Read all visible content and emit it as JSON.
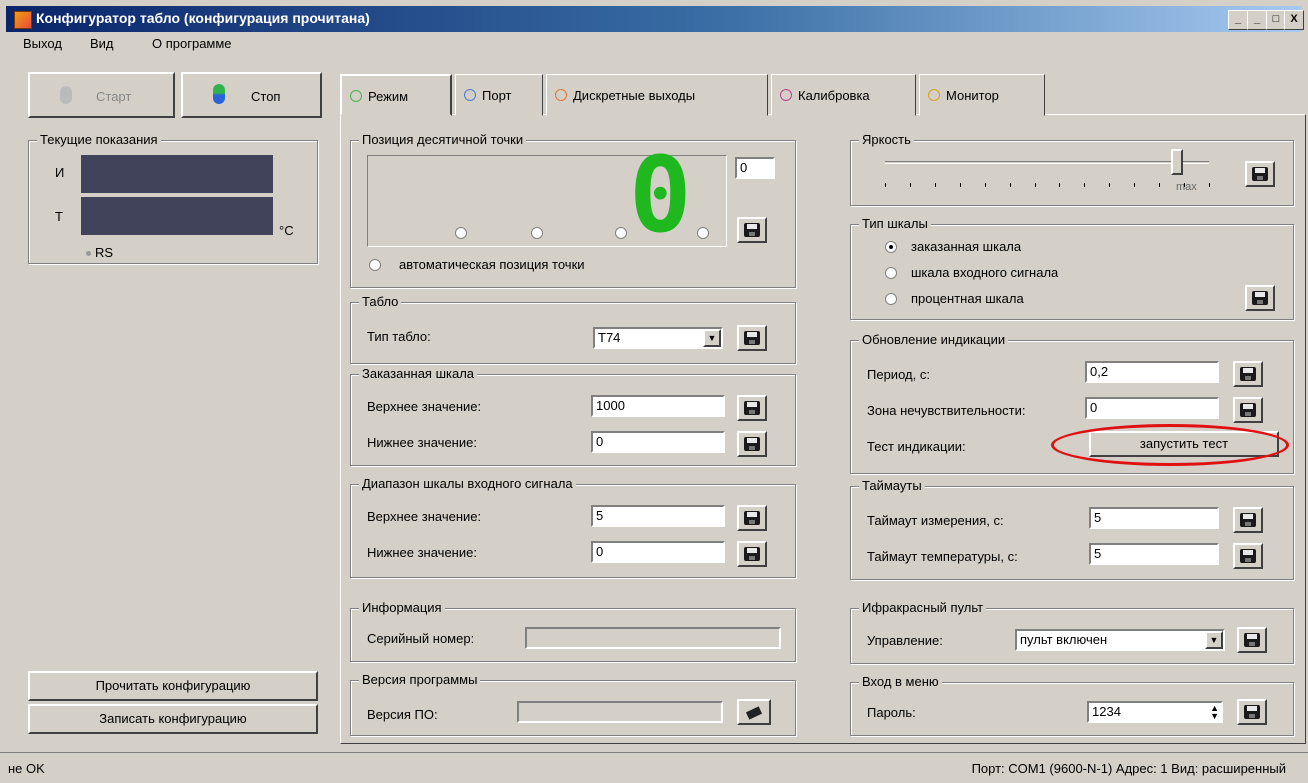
{
  "window": {
    "title": "Конфигуратор табло (конфигурация прочитана)",
    "min": "_",
    "min2": "_",
    "max": "□",
    "close": "X"
  },
  "menu": {
    "items": [
      "Выход",
      "Вид",
      "О программе"
    ]
  },
  "toolbar": {
    "start": "Старт",
    "stop": "Стоп"
  },
  "current": {
    "legend": "Текущие показания",
    "i_label": "И",
    "t_label": "Т",
    "unit": "°С",
    "rs": "RS"
  },
  "left_buttons": {
    "read": "Прочитать конфигурацию",
    "write": "Записать конфигурацию"
  },
  "tabs": [
    {
      "label": "Режим",
      "color": "#4caf50"
    },
    {
      "label": "Порт",
      "color": "#4a7bd0"
    },
    {
      "label": "Дискретные выходы",
      "color": "#e0763a"
    },
    {
      "label": "Калибровка",
      "color": "#c0408a"
    },
    {
      "label": "Монитор",
      "color": "#d4a020"
    }
  ],
  "decimal": {
    "legend": "Позиция десятичной точки",
    "value": "0",
    "digit": "0",
    "auto_label": "автоматическая позиция точки"
  },
  "tablo": {
    "legend": "Табло",
    "type_label": "Тип табло:",
    "type_value": "T74"
  },
  "ordered_scale": {
    "legend": "Заказанная шкала",
    "upper_label": "Верхнее значение:",
    "upper_value": "1000",
    "lower_label": "Нижнее значение:",
    "lower_value": "0"
  },
  "input_range": {
    "legend": "Диапазон шкалы входного сигнала",
    "upper_label": "Верхнее значение:",
    "upper_value": "5",
    "lower_label": "Нижнее значение:",
    "lower_value": "0"
  },
  "info": {
    "legend": "Информация",
    "serial_label": "Серийный номер:",
    "serial_value": ""
  },
  "version": {
    "legend": "Версия программы",
    "fw_label": "Версия ПО:",
    "fw_value": ""
  },
  "brightness": {
    "legend": "Яркость",
    "max_label": "max",
    "level": 0.9
  },
  "scale_type": {
    "legend": "Тип шкалы",
    "options": [
      "заказанная шкала",
      "шкала входного сигнала",
      "процентная шкала"
    ],
    "selected": 0
  },
  "refresh": {
    "legend": "Обновление индикации",
    "period_label": "Период, с:",
    "period_value": "0,2",
    "deadband_label": "Зона нечувствительности:",
    "deadband_value": "0",
    "test_label": "Тест индикации:",
    "test_button": "запустить тест"
  },
  "timeouts": {
    "legend": "Таймауты",
    "meas_label": "Таймаут измерения, с:",
    "meas_value": "5",
    "temp_label": "Таймаут температуры, с:",
    "temp_value": "5"
  },
  "ir": {
    "legend": "Ифракрасный пульт",
    "control_label": "Управление:",
    "control_value": "пульт включен"
  },
  "menu_entry": {
    "legend": "Вход в меню",
    "password_label": "Пароль:",
    "password_value": "1234"
  },
  "status": {
    "left": "не OK",
    "right": "Порт: COM1 (9600-N-1)  Адрес: 1  Вид: расширенный"
  },
  "colors": {
    "highlight": "#e01010",
    "lcd": "#40435a",
    "segment": "#1fb81f"
  }
}
